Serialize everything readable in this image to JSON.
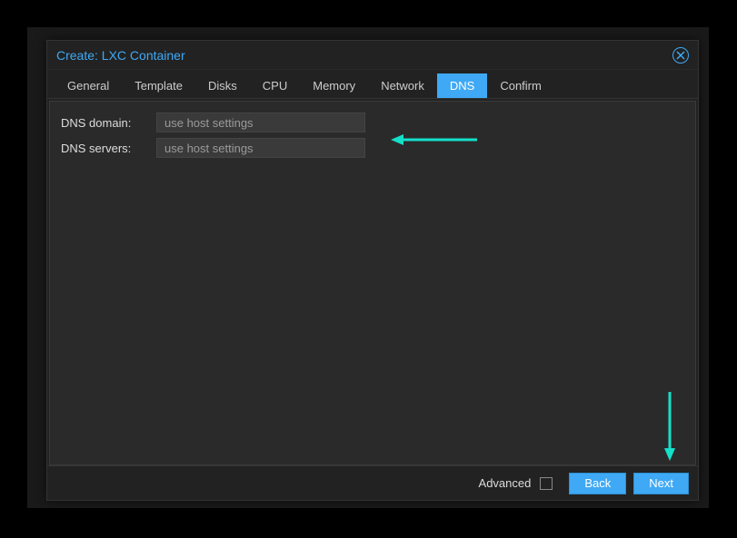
{
  "dialog": {
    "title": "Create: LXC Container"
  },
  "tabs": {
    "items": [
      {
        "label": "General"
      },
      {
        "label": "Template"
      },
      {
        "label": "Disks"
      },
      {
        "label": "CPU"
      },
      {
        "label": "Memory"
      },
      {
        "label": "Network"
      },
      {
        "label": "DNS"
      },
      {
        "label": "Confirm"
      }
    ],
    "active_index": 6
  },
  "form": {
    "dns_domain": {
      "label": "DNS domain:",
      "value": "",
      "placeholder": "use host settings"
    },
    "dns_servers": {
      "label": "DNS servers:",
      "value": "",
      "placeholder": "use host settings"
    }
  },
  "footer": {
    "advanced_label": "Advanced",
    "advanced_checked": false,
    "back_label": "Back",
    "next_label": "Next"
  },
  "colors": {
    "accent": "#3fa9f5",
    "annotation": "#14e0c9"
  }
}
